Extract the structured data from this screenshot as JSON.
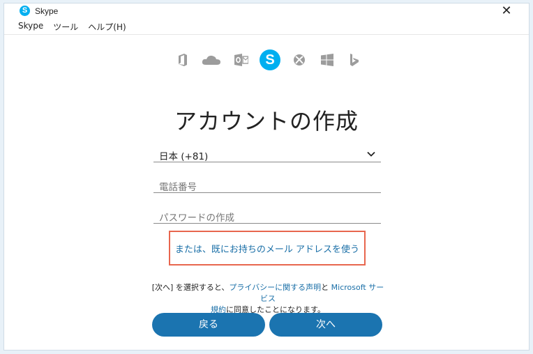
{
  "window": {
    "title": "Skype",
    "close_glyph": "✕"
  },
  "menu": {
    "skype": "Skype",
    "tools": "ツール",
    "help": "ヘルプ(H)"
  },
  "product_icons": [
    "office-icon",
    "onedrive-icon",
    "outlook-icon",
    "skype-icon",
    "xbox-icon",
    "windows-icon",
    "bing-icon"
  ],
  "heading": "アカウントの作成",
  "form": {
    "country": "日本 (+81)",
    "phone_placeholder": "電話番号",
    "password_placeholder": "パスワードの作成"
  },
  "alt_link": "または、既にお持ちのメール アドレスを使う",
  "terms": {
    "prefix": "[次へ] を選択すると、",
    "privacy_link": "プライバシーに関する声明",
    "and": "と",
    "services_link_1": "Microsoft サービス",
    "services_link_2": "規約",
    "suffix": "に同意したことになります。"
  },
  "buttons": {
    "back": "戻る",
    "next": "次へ"
  },
  "colors": {
    "accent": "#1b74b0",
    "link": "#1a6fa7",
    "skype_brand": "#00aff0",
    "highlight_box": "#e8664e",
    "icon_gray": "#9c9c9c"
  }
}
